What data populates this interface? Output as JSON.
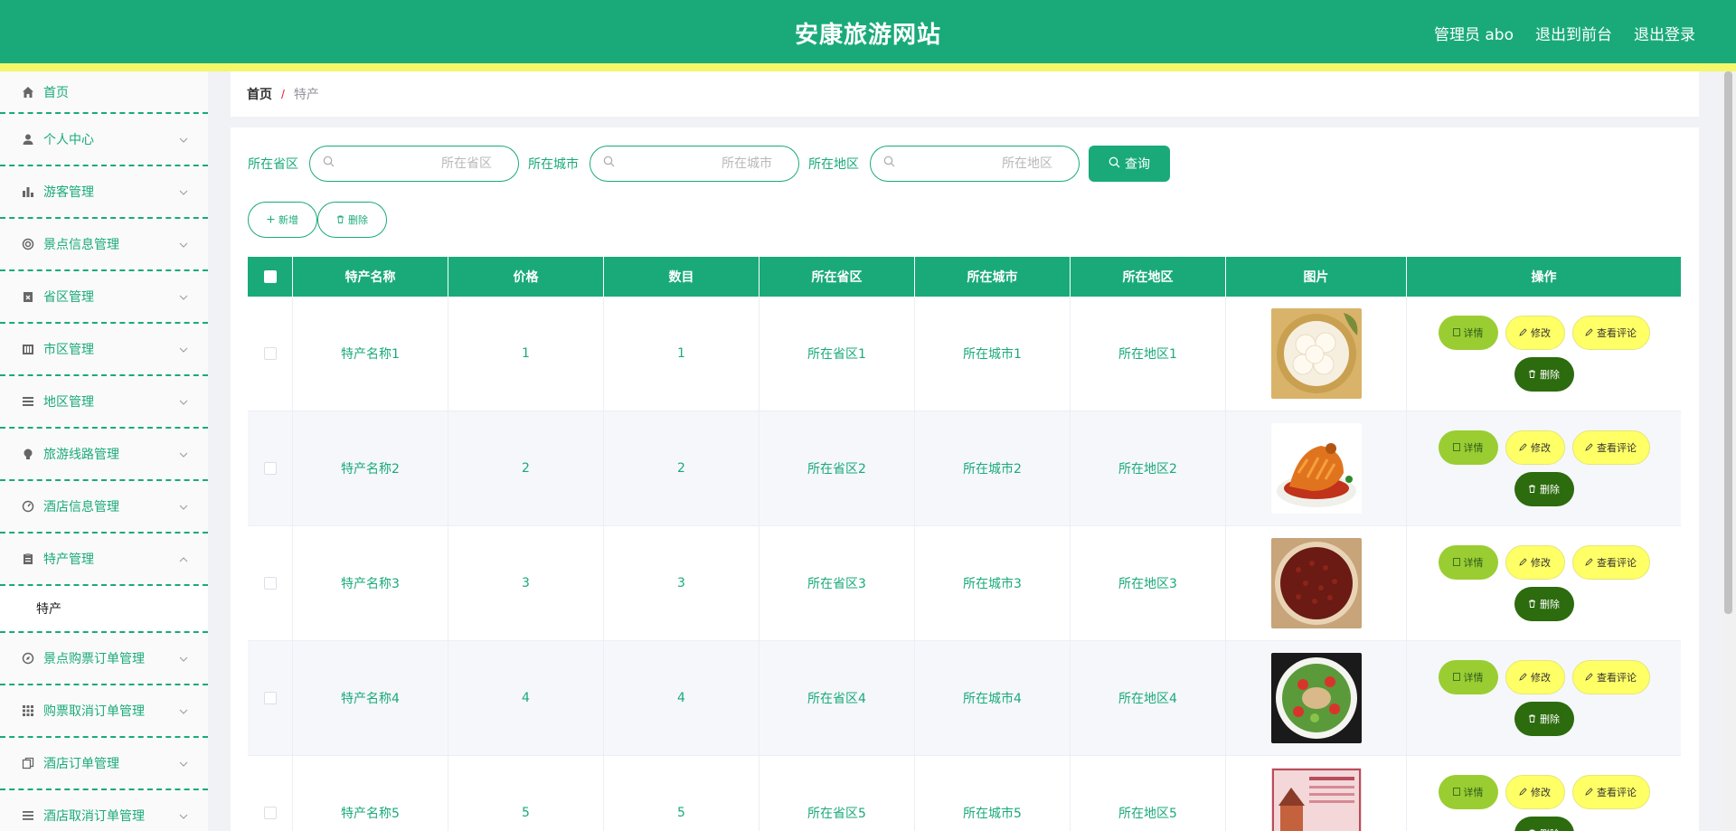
{
  "header": {
    "title": "安康旅游网站",
    "admin_label": "管理员 abo",
    "to_front": "退出到前台",
    "logout": "退出登录",
    "bg_color": "#1aaa7a",
    "stripe_color": "#f4f76a"
  },
  "sidebar": {
    "items": [
      {
        "label": "首页",
        "icon": "home-icon"
      },
      {
        "label": "个人中心",
        "icon": "user-icon"
      },
      {
        "label": "游客管理",
        "icon": "bar-chart-icon"
      },
      {
        "label": "景点信息管理",
        "icon": "ring-icon"
      },
      {
        "label": "省区管理",
        "icon": "clipboard-x-icon"
      },
      {
        "label": "市区管理",
        "icon": "building-icon"
      },
      {
        "label": "地区管理",
        "icon": "list-icon"
      },
      {
        "label": "旅游线路管理",
        "icon": "bulb-icon"
      },
      {
        "label": "酒店信息管理",
        "icon": "gauge-icon"
      },
      {
        "label": "特产管理",
        "icon": "clipboard-icon"
      },
      {
        "label": "景点购票订单管理",
        "icon": "compass-icon"
      },
      {
        "label": "购票取消订单管理",
        "icon": "grid-icon"
      },
      {
        "label": "酒店订单管理",
        "icon": "copy-icon"
      },
      {
        "label": "酒店取消订单管理",
        "icon": "menu-icon"
      }
    ],
    "submenu_label": "特产"
  },
  "breadcrumb": {
    "home": "首页",
    "separator": "/",
    "current": "特产"
  },
  "search": {
    "province_label": "所在省区",
    "province_placeholder": "所在省区",
    "city_label": "所在城市",
    "city_placeholder": "所在城市",
    "district_label": "所在地区",
    "district_placeholder": "所在地区",
    "query_button": "查询"
  },
  "actions": {
    "add": "新增",
    "delete": "删除"
  },
  "table": {
    "headers": [
      "特产名称",
      "价格",
      "数目",
      "所在省区",
      "所在城市",
      "所在地区",
      "图片",
      "操作"
    ],
    "rows": [
      {
        "name": "特产名称1",
        "price": "1",
        "count": "1",
        "province": "所在省区1",
        "city": "所在城市1",
        "district": "所在地区1",
        "image": "steamed-buns"
      },
      {
        "name": "特产名称2",
        "price": "2",
        "count": "2",
        "province": "所在省区2",
        "city": "所在城市2",
        "district": "所在地区2",
        "image": "braised-fish"
      },
      {
        "name": "特产名称3",
        "price": "3",
        "count": "3",
        "province": "所在省区3",
        "city": "所在城市3",
        "district": "所在地区3",
        "image": "red-beans"
      },
      {
        "name": "特产名称4",
        "price": "4",
        "count": "4",
        "province": "所在省区4",
        "city": "所在城市4",
        "district": "所在地区4",
        "image": "salad"
      },
      {
        "name": "特产名称5",
        "price": "5",
        "count": "5",
        "province": "所在省区5",
        "city": "所在城市5",
        "district": "所在地区5",
        "image": "poster"
      }
    ],
    "ops": {
      "detail": "详情",
      "edit": "修改",
      "review": "查看评论",
      "delete": "删除"
    }
  }
}
